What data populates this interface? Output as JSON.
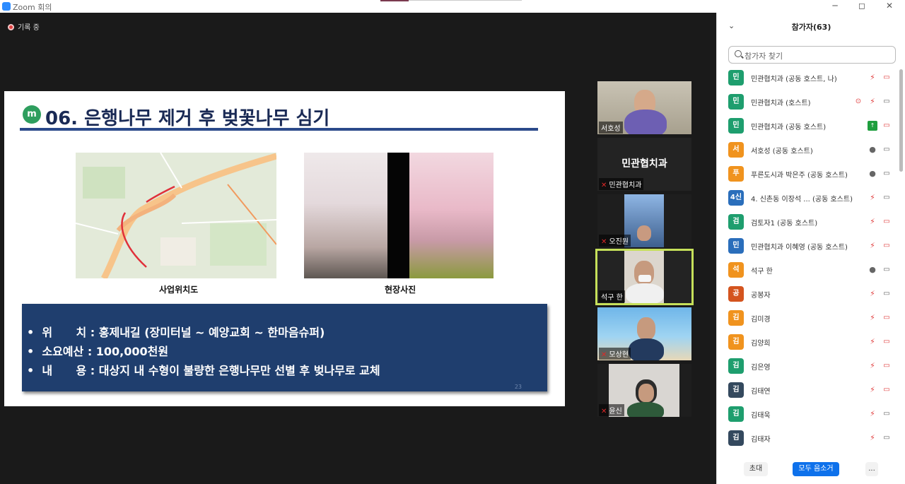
{
  "window": {
    "title": "Zoom 회의",
    "controls": [
      "─",
      "◻",
      "✕"
    ]
  },
  "recording": {
    "label": "기록 중"
  },
  "slide": {
    "logo": "m",
    "title": "06. 은행나무 제거 후 벚꽃나무 심기",
    "map_caption": "사업위치도",
    "photo_caption": "현장사진",
    "lines": [
      "•  위      치 : 홍제내길 (장미터널 ~ 예양교회 ~ 한마음슈퍼)",
      "•  소요예산 : 100,000천원",
      "•  내      용 : 대상지 내 수형이 불량한 은행나무만 선별 후 벚나무로 교체"
    ],
    "page_number": "23"
  },
  "videos": [
    {
      "name": "서호성",
      "muted": false
    },
    {
      "name": "민관협치과",
      "center": "민관협치과",
      "muted": true
    },
    {
      "name": "오진원",
      "muted": true
    },
    {
      "name": "석구 한",
      "muted": false,
      "active": true
    },
    {
      "name": "모상현",
      "muted": true
    },
    {
      "name": "윤신",
      "muted": true
    }
  ],
  "panel": {
    "title": "참가자(63)",
    "search_placeholder": "참가자 찾기",
    "participants": [
      {
        "avatar": "민",
        "color": "#1e9e6e",
        "name": "민관협치과 (공동 호스트, 나)",
        "mic": "muted",
        "cam": "off"
      },
      {
        "avatar": "민",
        "color": "#1e9e6e",
        "name": "민관협치과 (호스트)",
        "mic": "muted",
        "cam": "on",
        "rec": true
      },
      {
        "avatar": "민",
        "color": "#1e9e6e",
        "name": "민관협치과 (공동 호스트)",
        "mic": "share",
        "cam": "off"
      },
      {
        "avatar": "서",
        "color": "#f0931e",
        "name": "서호성 (공동 호스트)",
        "mic": "on",
        "cam": "on"
      },
      {
        "avatar": "푸",
        "color": "#f0931e",
        "name": "푸른도시과 박은주 (공동 호스트)",
        "mic": "on",
        "cam": "on"
      },
      {
        "avatar": "4신",
        "color": "#2a6ebb",
        "name": "4. 신촌동 이장석 ... (공동 호스트)",
        "mic": "muted",
        "cam": "on"
      },
      {
        "avatar": "검",
        "color": "#1e9e6e",
        "name": "검토자1 (공동 호스트)",
        "mic": "muted",
        "cam": "off"
      },
      {
        "avatar": "민",
        "color": "#2a6ebb",
        "name": "민관협치과 이혜영 (공동 호스트)",
        "mic": "muted",
        "cam": "off"
      },
      {
        "avatar": "석",
        "color": "#f0931e",
        "name": "석구 한",
        "mic": "on",
        "cam": "on"
      },
      {
        "avatar": "공",
        "color": "#d4541e",
        "name": "공봉자",
        "mic": "muted",
        "cam": "on"
      },
      {
        "avatar": "김",
        "color": "#f0931e",
        "name": "김미경",
        "mic": "muted",
        "cam": "off"
      },
      {
        "avatar": "김",
        "color": "#f0931e",
        "name": "김양희",
        "mic": "muted",
        "cam": "off"
      },
      {
        "avatar": "김",
        "color": "#1e9e6e",
        "name": "김은영",
        "mic": "muted",
        "cam": "off"
      },
      {
        "avatar": "김",
        "color": "#34495e",
        "name": "김태연",
        "mic": "muted",
        "cam": "off"
      },
      {
        "avatar": "김",
        "color": "#1e9e6e",
        "name": "김태욱",
        "mic": "muted",
        "cam": "on"
      },
      {
        "avatar": "김",
        "color": "#34495e",
        "name": "김태자",
        "mic": "muted",
        "cam": "on"
      }
    ],
    "footer": {
      "invite": "초대",
      "mute_all": "모두 음소거",
      "more": "..."
    }
  },
  "icons": {
    "mic_on": "🎤",
    "mic_muted": "🎤̸",
    "cam_on": "▭",
    "cam_off": "▭̸",
    "chevron": "⌄"
  }
}
